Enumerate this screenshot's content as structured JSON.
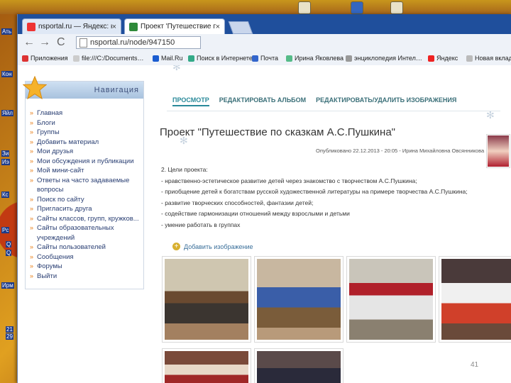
{
  "desktop": {
    "labels": [
      "Ать",
      "Кон",
      "Яйл",
      "Зи",
      "Иэ",
      "Кс",
      "Рс",
      "Q",
      "Q",
      "Ирм",
      "21",
      "29"
    ]
  },
  "browser": {
    "tabs": [
      {
        "label": "nsportal.ru — Яндекс: нашл",
        "close": "×"
      },
      {
        "label": "Проект 'Путешествие по ск",
        "close": "×"
      }
    ],
    "url": "nsportal.ru/node/947150",
    "nav": {
      "back": "←",
      "forward": "→",
      "reload": "C"
    },
    "bookmarks": [
      "Приложения",
      "file:///C:/Documents…",
      "Mail.Ru",
      "Поиск в Интернете",
      "Почта",
      "Ирина Яковлева",
      "энциклопедия Интел…",
      "Яндекс",
      "Новая вкладка"
    ]
  },
  "navigation": {
    "title": "Навигация",
    "items": [
      "Главная",
      "Блоги",
      "Группы",
      "Добавить материал",
      "Мои друзья",
      "Мои обсуждения и публикации",
      "Мой мини-сайт",
      "Ответы на часто задаваемые вопросы",
      "Поиск по сайту",
      "Пригласить друга",
      "Сайты классов, групп, кружков...",
      "Сайты образовательных учреждений",
      "Сайты пользователей",
      "Сообщения",
      "Форумы",
      "Выйти"
    ]
  },
  "content": {
    "tabs": [
      "ПРОСМОТР",
      "РЕДАКТИРОВАТЬ АЛЬБОМ",
      "РЕДАКТИРОВАТЬ/УДАЛИТЬ ИЗОБРАЖЕНИЯ"
    ],
    "title": "Проект \"Путешествие по сказкам А.С.Пушкина\"",
    "published": "Опубликовано 22.12.2013 - 20:05 - Ирина Михайловна Овсянникова",
    "lines": [
      "2. Цели проекта:",
      "- нравственно-эстетическое развитие детей через знакомство с творчеством А.С.Пушкина;",
      "- приобщение детей к богатствам русской художественной литературы на примере творчества А.С.Пушкина;",
      "- развитие творческих способностей, фантазии детей;",
      "- содействие гармонизации отношений между взрослыми и детьми",
      "- умение работать в группах"
    ],
    "add_image": "Добавить изображение"
  },
  "page_number": "41"
}
